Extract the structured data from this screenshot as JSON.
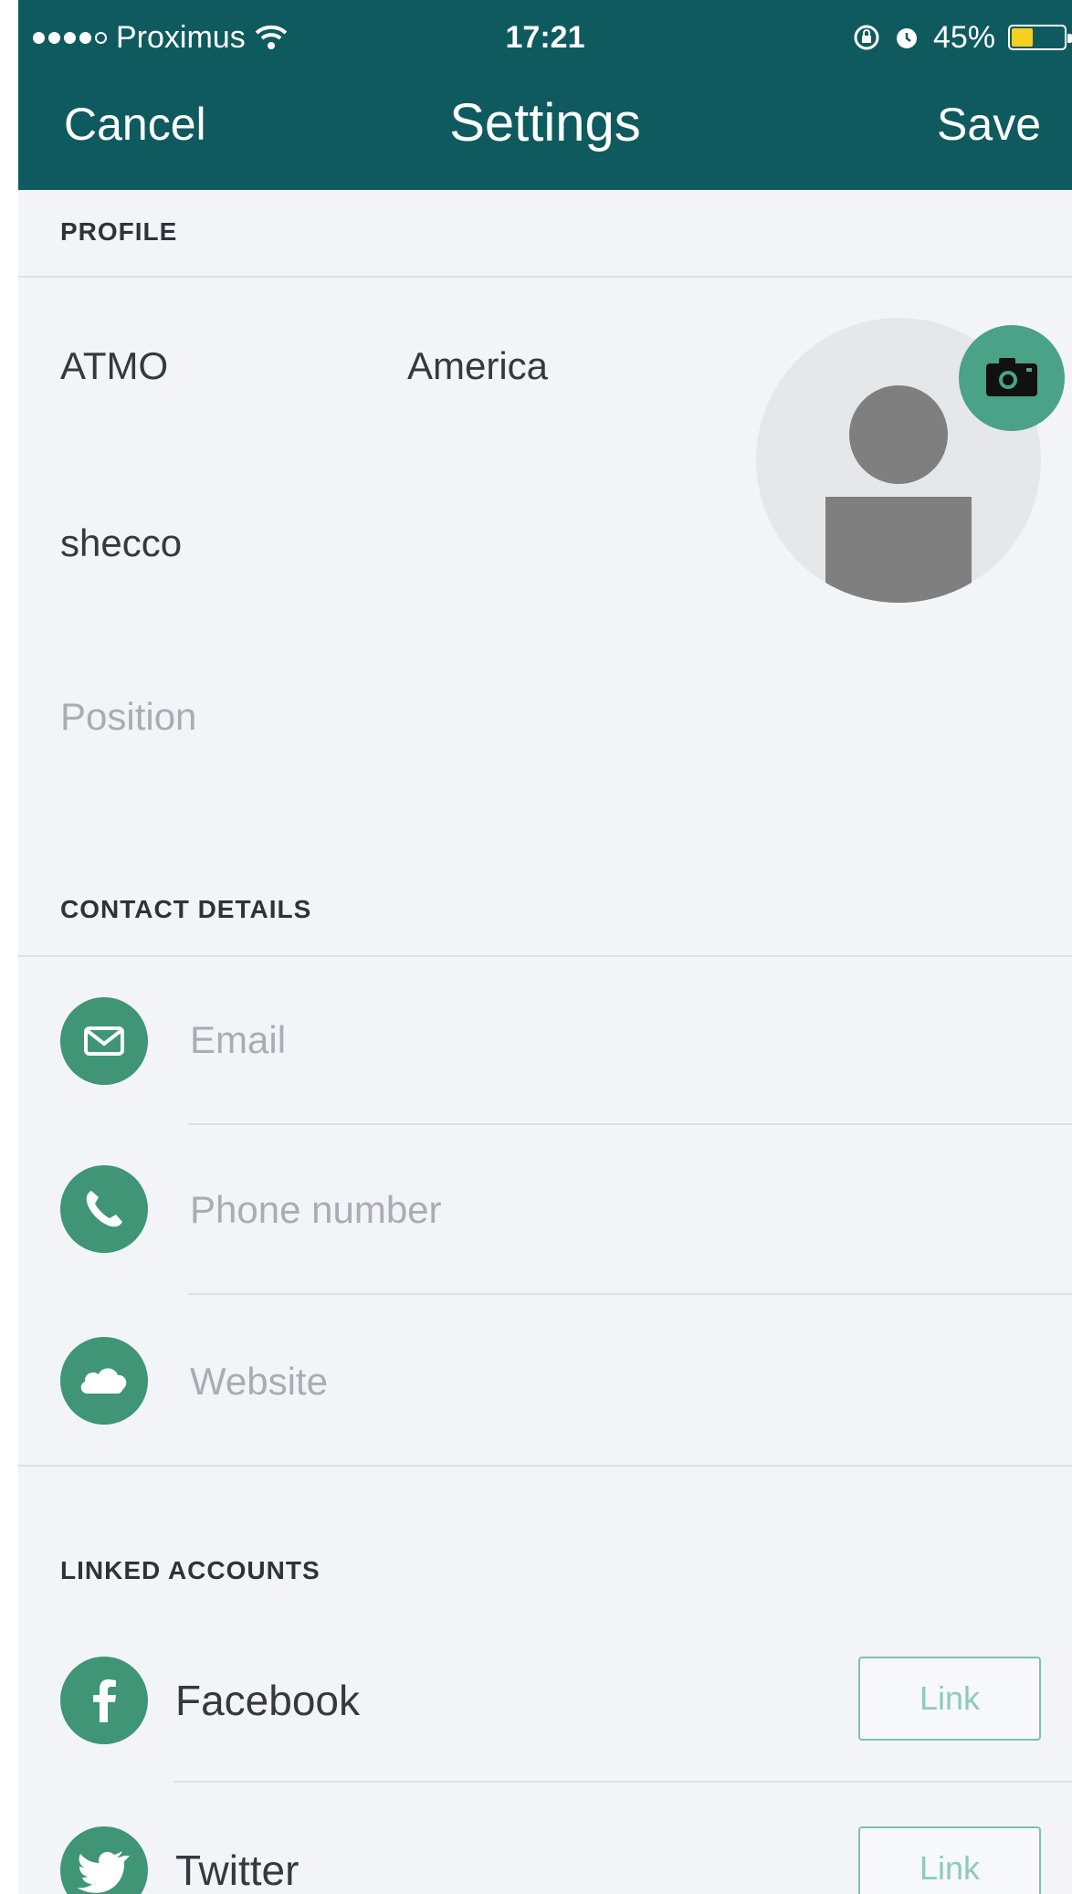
{
  "status_bar": {
    "carrier": "Proximus",
    "time": "17:21",
    "battery": "45%",
    "battery_fraction": 0.45
  },
  "nav": {
    "cancel": "Cancel",
    "title": "Settings",
    "save": "Save"
  },
  "profile": {
    "section_label": "PROFILE",
    "first_name": "ATMO",
    "last_name": "America",
    "username": "shecco",
    "position_placeholder": "Position"
  },
  "contact": {
    "section_label": "CONTACT DETAILS",
    "email_placeholder": "Email",
    "phone_placeholder": "Phone number",
    "website_placeholder": "Website"
  },
  "linked": {
    "section_label": "LINKED ACCOUNTS",
    "accounts": [
      {
        "name": "Facebook",
        "button": "Link"
      },
      {
        "name": "Twitter",
        "button": "Link"
      }
    ]
  },
  "colors": {
    "header": "#0f5a5e",
    "accent": "#3f9576",
    "background": "#f3f4f8"
  }
}
